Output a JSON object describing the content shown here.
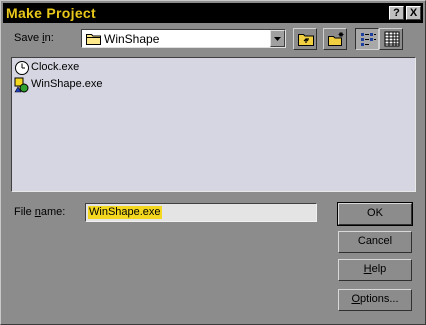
{
  "window": {
    "title": "Make Project",
    "help_button": "?",
    "close_button": "X"
  },
  "save_in": {
    "label_prefix": "Save ",
    "label_underlined": "i",
    "label_suffix": "n:",
    "folder": "WinShape"
  },
  "toolbar": {
    "icons": [
      "up-one-level-icon",
      "create-new-folder-icon",
      "list-view-icon",
      "details-view-icon"
    ]
  },
  "files": [
    {
      "name": "Clock.exe",
      "icon": "clock-icon"
    },
    {
      "name": "WinShape.exe",
      "icon": "shapes-app-icon"
    }
  ],
  "file_name": {
    "label_prefix": "File ",
    "label_underlined": "n",
    "label_suffix": "ame:",
    "value": "WinShape.exe"
  },
  "buttons": {
    "ok": "OK",
    "cancel": "Cancel",
    "help_underlined": "H",
    "help_rest": "elp",
    "options_underlined": "O",
    "options_rest": "ptions..."
  },
  "colors": {
    "title_text": "#e8c81a",
    "selection": "#f4d820",
    "list_background": "#d6d6e2"
  }
}
